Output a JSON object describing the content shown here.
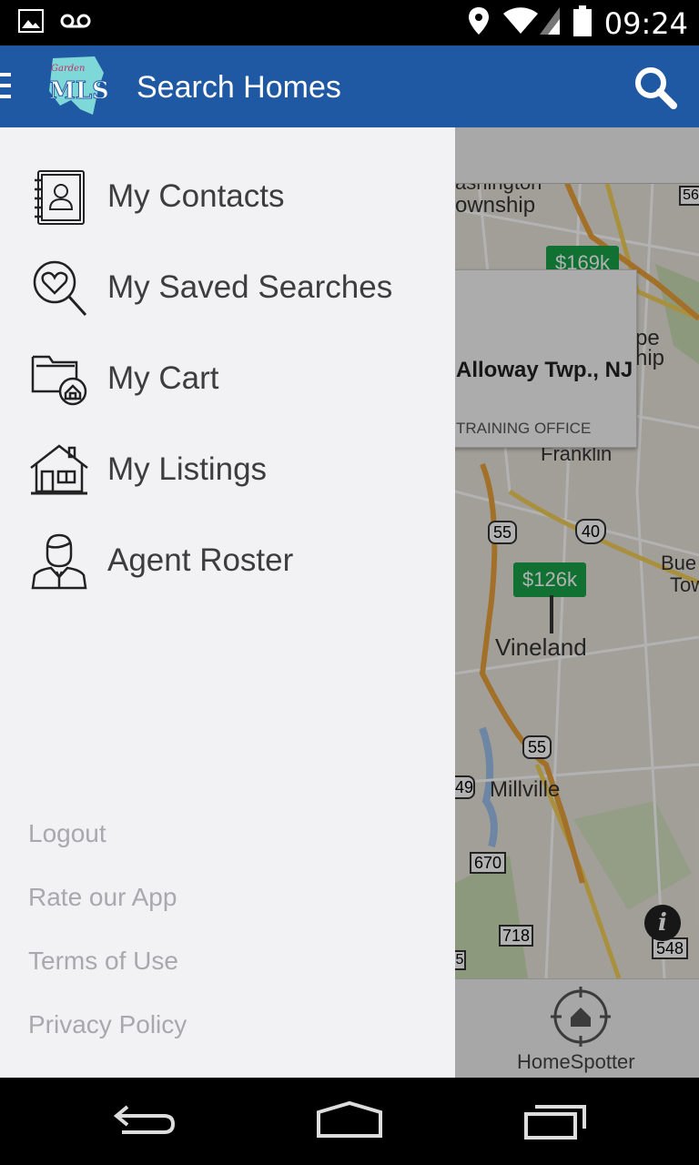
{
  "status_bar": {
    "time": "09:24",
    "icons": [
      "image-icon",
      "voicemail-icon",
      "location-icon",
      "wifi-icon",
      "signal-icon",
      "battery-icon"
    ]
  },
  "app_bar": {
    "title": "Search Homes",
    "logo": "mls-logo",
    "color": "#1f58a3"
  },
  "drawer": {
    "items": [
      {
        "label": "My Contacts",
        "icon": "contacts-book-icon"
      },
      {
        "label": "My Saved Searches",
        "icon": "heart-search-icon"
      },
      {
        "label": "My Cart",
        "icon": "folder-home-icon"
      },
      {
        "label": "My Listings",
        "icon": "house-icon"
      },
      {
        "label": "Agent Roster",
        "icon": "agent-person-icon"
      }
    ],
    "footer": [
      {
        "label": "Logout"
      },
      {
        "label": "Rate our App"
      },
      {
        "label": "Terms of Use"
      },
      {
        "label": "Privacy Policy"
      }
    ]
  },
  "map": {
    "labels": {
      "washington": "ashington",
      "township": "ownship",
      "franklin": "Franklin",
      "vineland": "Vineland",
      "millville": "Millville",
      "ship": "hip",
      "be": "pe",
      "bue": "Bue",
      "tow": "Tow"
    },
    "route_shields": [
      "55",
      "40",
      "55",
      "670",
      "718",
      "548",
      "49",
      "56",
      "5"
    ],
    "price_pins": [
      "$126k",
      "$169k"
    ],
    "popup": {
      "title": "Alloway Twp., NJ",
      "subtitle": "TRAINING OFFICE"
    }
  },
  "homespotter": {
    "label": "HomeSpotter"
  }
}
